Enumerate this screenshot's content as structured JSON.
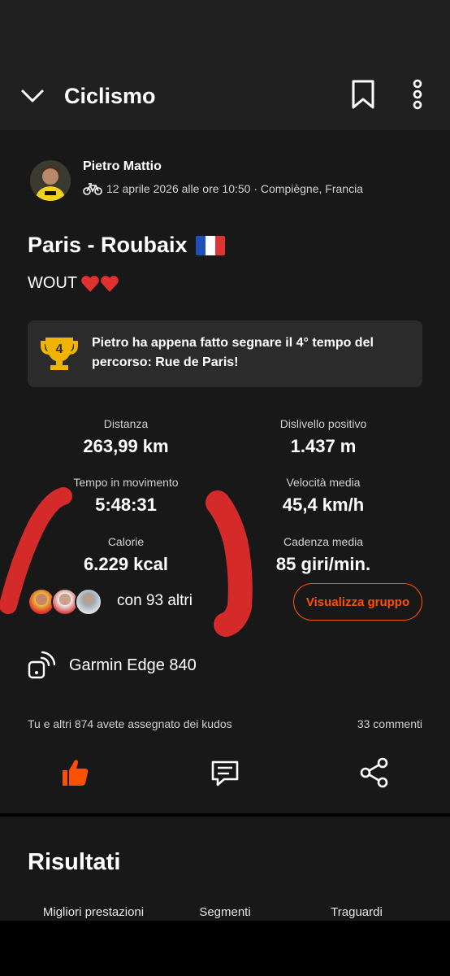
{
  "header": {
    "title": "Ciclismo"
  },
  "activity": {
    "athlete": "Pietro Mattio",
    "meta": "12 aprile 2026 alle ore 10:50 · Compiègne, Francia",
    "title": "Paris - Roubaix",
    "description": "WOUT",
    "achievement": "Pietro ha appena fatto segnare il 4° tempo del percorso: Rue de Paris!",
    "trophy_rank": "4"
  },
  "stats": [
    {
      "label": "Distanza",
      "value": "263,99 km"
    },
    {
      "label": "Dislivello positivo",
      "value": "1.437 m"
    },
    {
      "label": "Tempo in movimento",
      "value": "5:48:31"
    },
    {
      "label": "Velocità media",
      "value": "45,4 km/h"
    },
    {
      "label": "Calorie",
      "value": "6.229 kcal"
    },
    {
      "label": "Cadenza media",
      "value": "85 giri/min."
    }
  ],
  "group": {
    "others": "con 93 altri",
    "button": "Visualizza gruppo"
  },
  "device": {
    "name": "Garmin Edge 840"
  },
  "social": {
    "kudos": "Tu e altri 874 avete assegnato dei kudos",
    "comments": "33 commenti"
  },
  "results": {
    "title": "Risultati",
    "tabs": [
      "Migliori prestazioni",
      "Segmenti",
      "Traguardi"
    ]
  },
  "colors": {
    "accent": "#fc5200",
    "background": "#181818",
    "appbar": "#202020",
    "trophy": "#f0b400",
    "scribble": "#d42a2a"
  }
}
